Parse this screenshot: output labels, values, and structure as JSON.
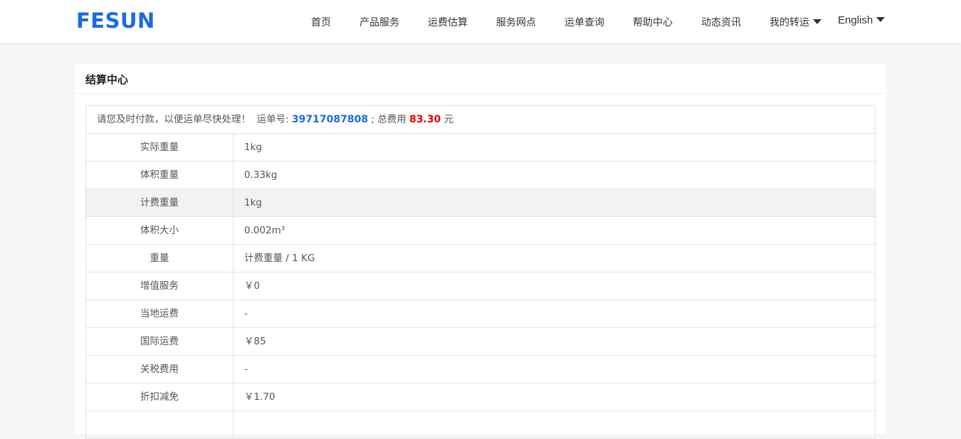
{
  "header": {
    "logo": "FESUN",
    "nav": [
      {
        "label": "首页"
      },
      {
        "label": "产品服务"
      },
      {
        "label": "运费估算"
      },
      {
        "label": "服务网点"
      },
      {
        "label": "运单查询"
      },
      {
        "label": "帮助中心"
      },
      {
        "label": "动态资讯"
      },
      {
        "label": "我的转运"
      }
    ],
    "language": "English"
  },
  "panel": {
    "title": "结算中心",
    "notice": {
      "prefix": "请您及时付款，以便运单尽快处理！  运单号: ",
      "waybill": "39717087808",
      "middle": " ; 总费用 ",
      "total": "83.30",
      "suffix": " 元"
    },
    "rows": [
      {
        "label": "实际重量",
        "value": "1kg"
      },
      {
        "label": "体积重量",
        "value": "0.33kg"
      },
      {
        "label": "计费重量",
        "value": "1kg"
      },
      {
        "label": "体积大小",
        "value": "0.002m³"
      },
      {
        "label": "重量",
        "value": "计费重量 / 1 KG"
      },
      {
        "label": "增值服务",
        "value": "￥0"
      },
      {
        "label": "当地运费",
        "value": "-"
      },
      {
        "label": "国际运费",
        "value": "￥85"
      },
      {
        "label": "关税费用",
        "value": "-"
      },
      {
        "label": "折扣减免",
        "value": "￥1.70"
      },
      {
        "label": "",
        "value": ""
      }
    ]
  },
  "colors": {
    "brand": "#1b6ae6",
    "total_fee": "#e00000",
    "highlight_row": "#f2f2f2"
  }
}
